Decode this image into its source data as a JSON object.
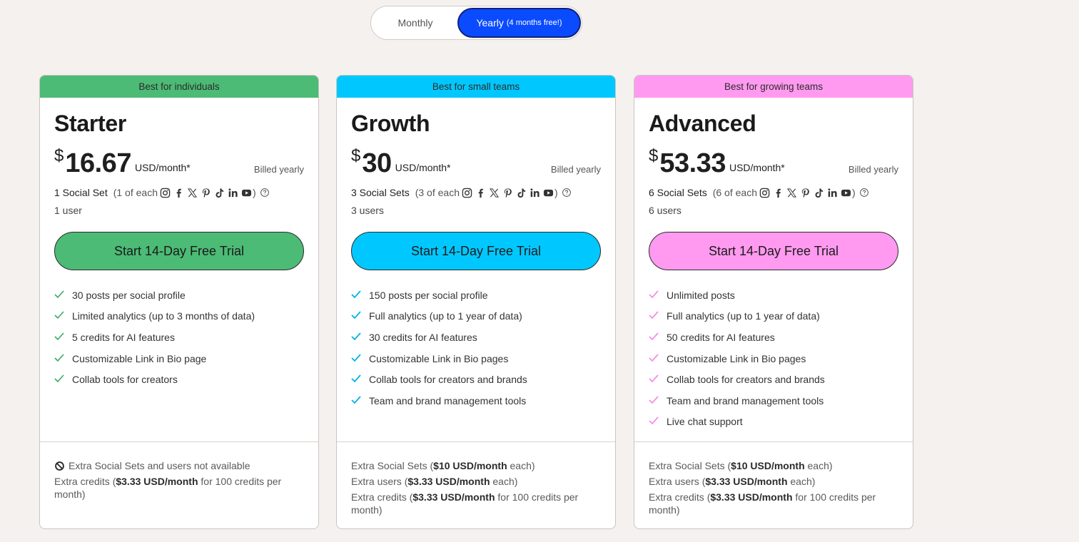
{
  "billing_toggle": {
    "monthly_label": "Monthly",
    "yearly_label": "Yearly",
    "yearly_badge": "(4 months free!)",
    "selected": "yearly",
    "accent_color": "#0a4bff"
  },
  "plans": [
    {
      "id": "starter",
      "banner": "Best for individuals",
      "accent_color": "#4cbb75",
      "name": "Starter",
      "currency": "$",
      "price": "16.67",
      "unit": "USD/month*",
      "billed": "Billed yearly",
      "social_sets": "1 Social Set",
      "each": "(1 of each",
      "close_paren": ")",
      "users": "1 user",
      "cta": "Start 14-Day Free Trial",
      "features": [
        "30 posts per social profile",
        "Limited analytics (up to 3 months of data)",
        "5 credits for AI features",
        "Customizable Link in Bio page",
        "Collab tools for creators"
      ],
      "footer": {
        "not_available": "Extra Social Sets and users not available",
        "extra_credits_prefix": "Extra credits (",
        "extra_credits_price": "$3.33 USD/month",
        "extra_credits_suffix": " for 100 credits per month)"
      }
    },
    {
      "id": "growth",
      "banner": "Best for small teams",
      "accent_color": "#00c8ff",
      "name": "Growth",
      "currency": "$",
      "price": "30",
      "unit": "USD/month*",
      "billed": "Billed yearly",
      "social_sets": "3 Social Sets",
      "each": "(3 of each",
      "close_paren": ")",
      "users": "3 users",
      "cta": "Start 14-Day Free Trial",
      "features": [
        "150 posts per social profile",
        "Full analytics (up to 1 year of data)",
        "30 credits for AI features",
        "Customizable Link in Bio pages",
        "Collab tools for creators and brands",
        "Team and brand management tools"
      ],
      "footer": {
        "extra_sets_prefix": "Extra Social Sets (",
        "extra_sets_price": "$10 USD/month",
        "extra_sets_suffix": " each)",
        "extra_users_prefix": "Extra users (",
        "extra_users_price": "$3.33 USD/month",
        "extra_users_suffix": " each)",
        "extra_credits_prefix": "Extra credits (",
        "extra_credits_price": "$3.33 USD/month",
        "extra_credits_suffix": " for 100 credits per month)"
      }
    },
    {
      "id": "advanced",
      "banner": "Best for growing teams",
      "accent_color": "#ff9af0",
      "name": "Advanced",
      "currency": "$",
      "price": "53.33",
      "unit": "USD/month*",
      "billed": "Billed yearly",
      "social_sets": "6 Social Sets",
      "each": "(6 of each",
      "close_paren": ")",
      "users": "6 users",
      "cta": "Start 14-Day Free Trial",
      "features": [
        "Unlimited posts",
        "Full analytics (up to 1 year of data)",
        "50 credits for AI features",
        "Customizable Link in Bio pages",
        "Collab tools for creators and brands",
        "Team and brand management tools",
        "Live chat support"
      ],
      "footer": {
        "extra_sets_prefix": "Extra Social Sets (",
        "extra_sets_price": "$10 USD/month",
        "extra_sets_suffix": " each)",
        "extra_users_prefix": "Extra users (",
        "extra_users_price": "$3.33 USD/month",
        "extra_users_suffix": " each)",
        "extra_credits_prefix": "Extra credits (",
        "extra_credits_price": "$3.33 USD/month",
        "extra_credits_suffix": " for 100 credits per month)"
      }
    }
  ],
  "social_icons": [
    "instagram-icon",
    "facebook-icon",
    "x-icon",
    "pinterest-icon",
    "tiktok-icon",
    "linkedin-icon",
    "youtube-icon"
  ],
  "check_colors": {
    "starter": "#3aaa62",
    "growth": "#00b2e8",
    "advanced": "#f58de6"
  }
}
